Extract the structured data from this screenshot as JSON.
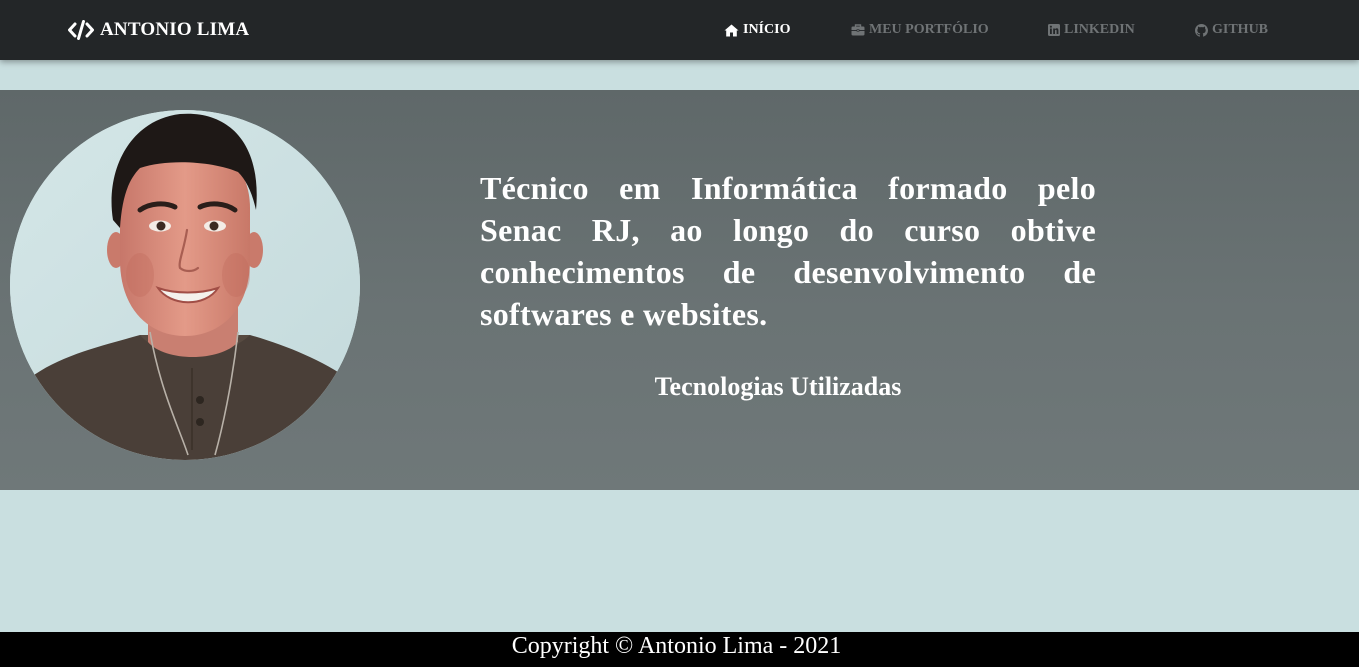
{
  "navbar": {
    "brand_name": "ANTONIO LIMA",
    "brand_icon": "code-icon",
    "items": [
      {
        "label": "INÍCIO",
        "icon": "home-icon",
        "active": true
      },
      {
        "label": "MEU PORTFÓLIO",
        "icon": "briefcase-icon",
        "active": false
      },
      {
        "label": "LINKEDIN",
        "icon": "linkedin-icon",
        "active": false
      },
      {
        "label": "GITHUB",
        "icon": "github-icon",
        "active": false
      }
    ]
  },
  "hero": {
    "bio": "Técnico em Informática formado pelo Senac RJ, ao longo do curso obtive conhecimentos de desenvolvimento de softwares e websites.",
    "tech_title": "Tecnologias Utilizadas"
  },
  "footer": {
    "copyright": "Copyright © Antonio Lima - 2021"
  },
  "colors": {
    "navbar_bg": "#232628",
    "nav_active": "#ffffff",
    "nav_inactive": "#6f7375",
    "page_bg": "#c9dfe0",
    "hero_bg": "#656e6f",
    "footer_bg": "#000000"
  }
}
